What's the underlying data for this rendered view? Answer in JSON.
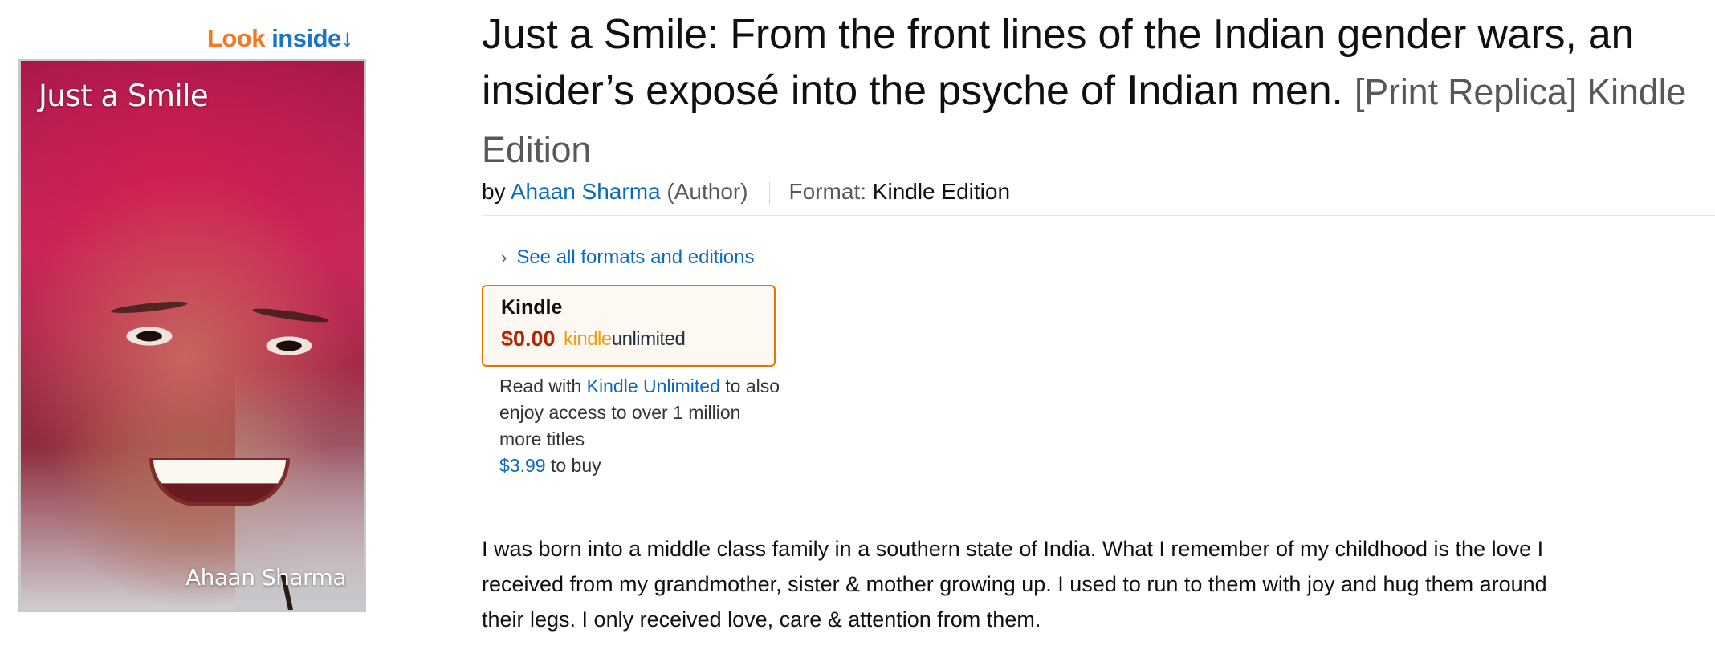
{
  "look_inside": {
    "look": "Look",
    "inside": "inside",
    "arrow": "↓"
  },
  "cover": {
    "title": "Just a Smile",
    "author": "Ahaan Sharma"
  },
  "product": {
    "title": "Just a Smile: From the front lines of the Indian gender wars, an insider’s exposé into the psyche of Indian men.",
    "binding": "[Print Replica] Kindle Edition"
  },
  "byline": {
    "by": "by",
    "author": "Ahaan Sharma",
    "role": "(Author)",
    "format_label": "Format:",
    "format_value": "Kindle Edition"
  },
  "formats": {
    "see_all": "See all formats and editions",
    "card": {
      "name": "Kindle",
      "price": "$0.00",
      "ku_kindle": "kindle",
      "ku_unlimited": "unlimited"
    }
  },
  "ku_note": {
    "read_with": "Read with",
    "ku_link": "Kindle Unlimited",
    "rest": "to also enjoy access to over 1 million more titles",
    "buy_price": "$3.99",
    "to_buy": "to buy"
  },
  "description": "I was born into a middle class family in a southern state of India. What I remember of my childhood is the love I received from my grandmother, sister & mother growing up. I used to run to them with joy and hug them around their legs. I only received love, care & attention from them.",
  "colors": {
    "link": "#0b6abf",
    "price": "#b12704",
    "card_border": "#e77600",
    "look_orange": "#f4781f"
  }
}
